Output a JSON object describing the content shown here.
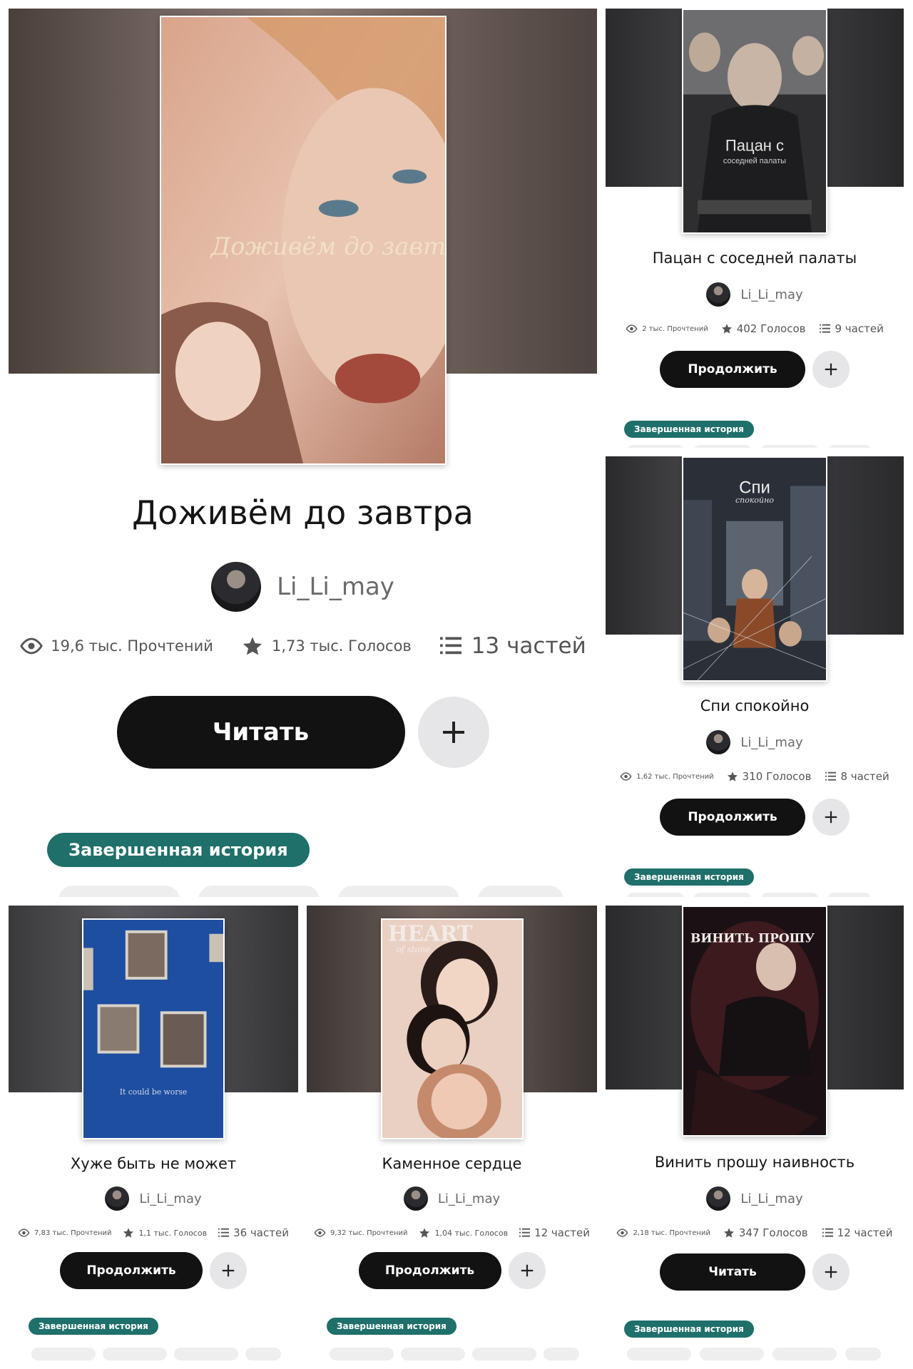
{
  "stories": [
    {
      "title": "Доживём до завтра",
      "cover_text": "Доживём до завтра",
      "author": "Li_Li_may",
      "reads": "19,6 тыс. Прочтений",
      "votes": "1,73 тыс. Голосов",
      "parts": "13 частей",
      "action": "Читать",
      "badge": "Завершенная история"
    },
    {
      "title": "Пацан с соседней палаты",
      "cover_text": "Пацан с",
      "cover_subtext": "соседней палаты",
      "author": "Li_Li_may",
      "reads": "2 тыс. Прочтений",
      "votes": "402 Голосов",
      "parts": "9 частей",
      "action": "Продолжить",
      "badge": "Завершенная история"
    },
    {
      "title": "Спи спокойно",
      "cover_text": "Спи",
      "cover_subtext": "спокойно",
      "author": "Li_Li_may",
      "reads": "1,62 тыс. Прочтений",
      "votes": "310 Голосов",
      "parts": "8 частей",
      "action": "Продолжить",
      "badge": "Завершенная история"
    },
    {
      "title": "Хуже быть не может",
      "cover_text": "It could be worse",
      "author": "Li_Li_may",
      "reads": "7,83 тыс. Прочтений",
      "votes": "1,1 тыс. Голосов",
      "parts": "36 частей",
      "action": "Продолжить",
      "badge": "Завершенная история"
    },
    {
      "title": "Каменное сердце",
      "cover_text": "HEART",
      "cover_subtext": "of stone",
      "author": "Li_Li_may",
      "reads": "9,32 тыс. Прочтений",
      "votes": "1,04 тыс. Голосов",
      "parts": "12 частей",
      "action": "Продолжить",
      "badge": "Завершенная история"
    },
    {
      "title": "Винить прошу наивность",
      "cover_text": "ВИНИТЬ ПРОШУ",
      "author": "Li_Li_may",
      "reads": "2,18 тыс. Прочтений",
      "votes": "347 Голосов",
      "parts": "12 частей",
      "action": "Читать",
      "badge": "Завершенная история"
    }
  ],
  "colors": {
    "badge": "#1f6f6a",
    "button": "#121212",
    "add_button": "#e6e6e8"
  }
}
